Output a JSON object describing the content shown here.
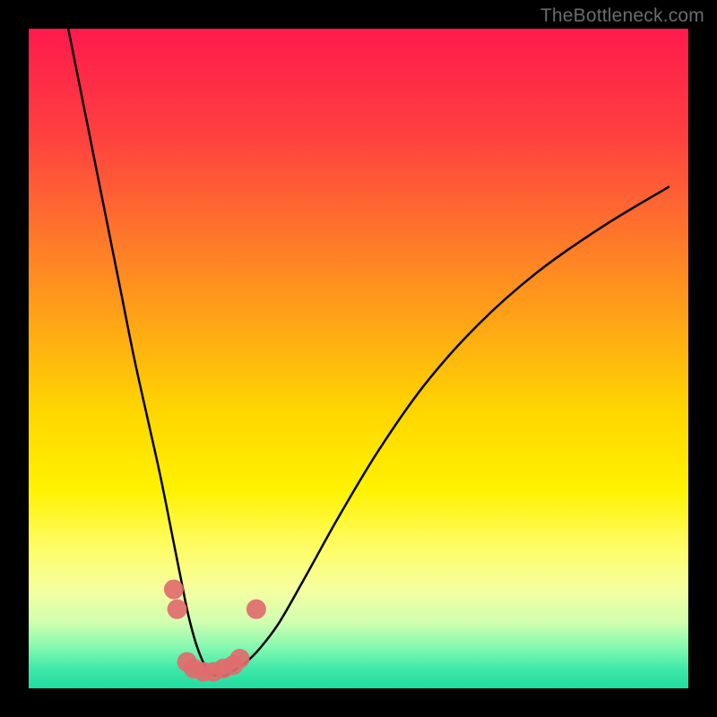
{
  "watermark": "TheBottleneck.com",
  "chart_data": {
    "type": "line",
    "title": "",
    "xlabel": "",
    "ylabel": "",
    "xlim": [
      0,
      100
    ],
    "ylim": [
      0,
      100
    ],
    "background_gradient_meaning": "top=red (high bottleneck), bottom=green (low bottleneck)",
    "series": [
      {
        "name": "bottleneck-curve",
        "x": [
          6,
          8,
          10,
          12,
          14,
          16,
          18,
          20,
          22,
          23,
          24,
          25,
          26,
          27,
          28,
          29,
          30,
          31.5,
          33,
          35,
          38,
          42,
          47,
          53,
          60,
          68,
          77,
          87,
          97
        ],
        "y": [
          100,
          90,
          80,
          70,
          60,
          50,
          41,
          32,
          22,
          17,
          12,
          8,
          5,
          3,
          2,
          2,
          2,
          3,
          4,
          6,
          10,
          17,
          26,
          36,
          46,
          55,
          63,
          70,
          76
        ]
      }
    ],
    "markers": {
      "name": "highlighted-points",
      "color": "#e06d6d",
      "points": [
        {
          "x": 22.0,
          "y": 15
        },
        {
          "x": 22.5,
          "y": 12
        },
        {
          "x": 24.0,
          "y": 4
        },
        {
          "x": 25.0,
          "y": 3
        },
        {
          "x": 26.5,
          "y": 2.5
        },
        {
          "x": 28.0,
          "y": 2.5
        },
        {
          "x": 29.5,
          "y": 3
        },
        {
          "x": 31.0,
          "y": 3.5
        },
        {
          "x": 32.0,
          "y": 4.5
        },
        {
          "x": 34.5,
          "y": 12
        }
      ]
    }
  }
}
